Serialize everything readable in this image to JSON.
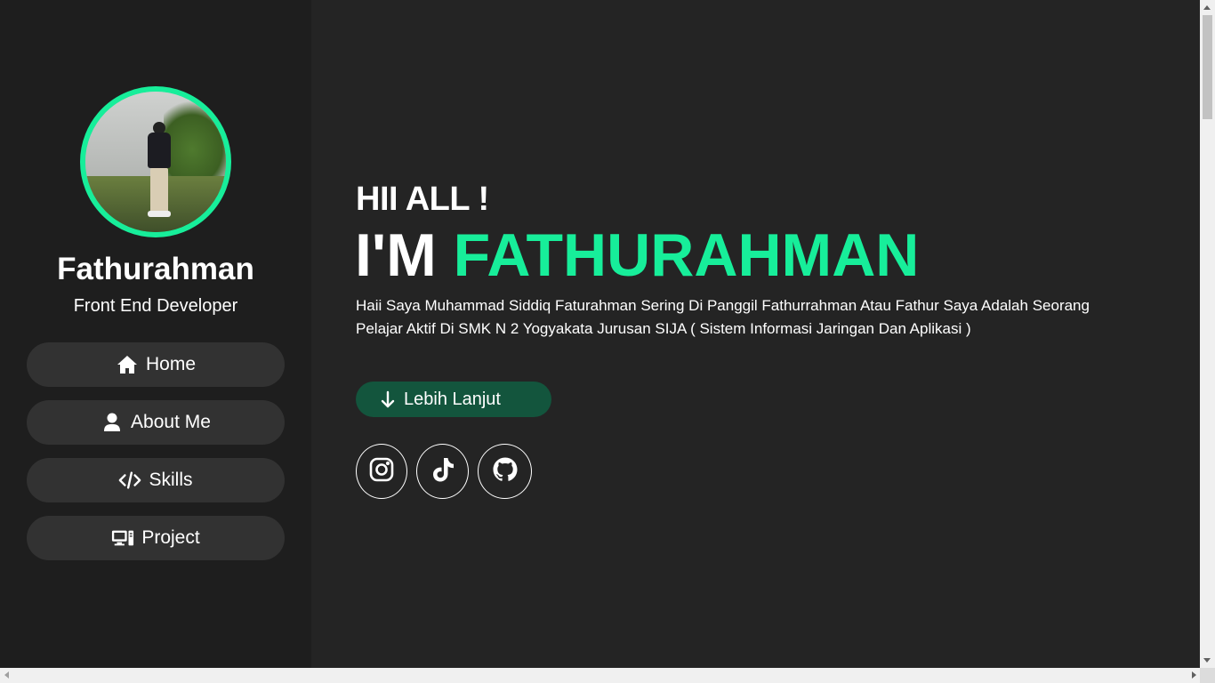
{
  "sidebar": {
    "name": "Fathurahman",
    "role": "Front End Developer",
    "nav": [
      {
        "label": "Home",
        "icon": "home-icon"
      },
      {
        "label": "About Me",
        "icon": "user-icon"
      },
      {
        "label": "Skills",
        "icon": "code-icon"
      },
      {
        "label": "Project",
        "icon": "desktop-icon"
      }
    ]
  },
  "hero": {
    "greeting": "HII ALL !",
    "intro_prefix": "I'M",
    "intro_name": "FATHURAHMAN",
    "bio": "Haii Saya Muhammad Siddiq Faturahman Sering Di Panggil Fathurrahman Atau Fathur Saya Adalah Seorang Pelajar Aktif Di SMK N 2 Yogyakata Jurusan SIJA ( Sistem Informasi Jaringan Dan Aplikasi )",
    "more_label": "Lebih Lanjut"
  },
  "social": [
    {
      "icon": "instagram-icon"
    },
    {
      "icon": "tiktok-icon"
    },
    {
      "icon": "github-icon"
    }
  ],
  "colors": {
    "accent": "#17ee9a",
    "sidebar_bg": "#1e1e1e",
    "main_bg": "#242424",
    "nav_bg": "#323232",
    "button_bg": "#13553d"
  }
}
